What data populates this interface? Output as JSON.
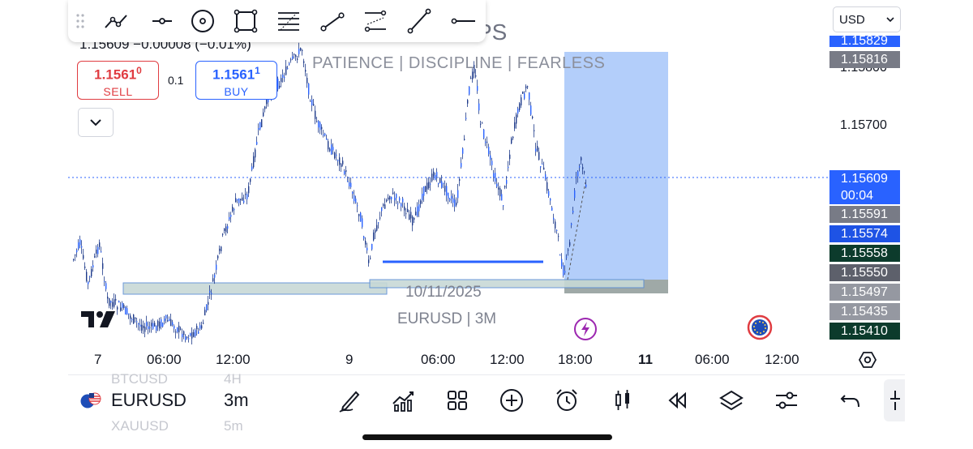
{
  "toolbar": {
    "tools": [
      "trend-line-tool",
      "horizontal-ray-tool",
      "circle-tool",
      "rectangle-tool",
      "fib-retracement-tool",
      "ray-tool",
      "parallel-channel-tool",
      "line-tool",
      "horizontal-line-tool"
    ]
  },
  "header": {
    "ohlc_text": "1.15609 −0.00008 (−0.01%)",
    "title_fragment": "PS",
    "motto": "PATIENCE  |  DISCIPLINE  |  FEARLESS",
    "lot_size": "0.1"
  },
  "trade": {
    "sell_price_main": "1.1561",
    "sell_price_sup": "0",
    "sell_label": "SELL",
    "buy_price_main": "1.1561",
    "buy_price_sup": "1",
    "buy_label": "BUY"
  },
  "currency_select": {
    "value": "USD"
  },
  "price_axis": {
    "plain_ticks": [
      "1.15800",
      "1.15700"
    ],
    "labels": [
      {
        "text": "1.15829",
        "bg": "#2962ff"
      },
      {
        "text": "1.15816",
        "bg": "#787b86"
      },
      {
        "text": "1.15609",
        "bg": "#2962ff"
      },
      {
        "text": "00:04",
        "bg": "#2962ff"
      },
      {
        "text": "1.15591",
        "bg": "#787b86"
      },
      {
        "text": "1.15574",
        "bg": "#1e53e5"
      },
      {
        "text": "1.15558",
        "bg": "#0c3b2c"
      },
      {
        "text": "1.15550",
        "bg": "#5d606b"
      },
      {
        "text": "1.15497",
        "bg": "#9598a1"
      },
      {
        "text": "1.15435",
        "bg": "#9598a1"
      },
      {
        "text": "1.15410",
        "bg": "#0c3b2c"
      }
    ]
  },
  "time_axis": [
    "7",
    "06:00",
    "12:00",
    "9",
    "06:00",
    "12:00",
    "18:00",
    "11",
    "06:00",
    "12:00"
  ],
  "watermark": {
    "date": "10/11/2025",
    "symbol": "EURUSD | 3M"
  },
  "bottom": {
    "symbol": "EURUSD",
    "interval": "3m",
    "ghost_prev_symbol": "BTCUSD",
    "ghost_prev_interval": "4H",
    "ghost_next_symbol": "XAUUSD",
    "ghost_next_interval": "5m",
    "icons": [
      "draw-icon",
      "indicators-icon",
      "layout-grid-icon",
      "add-icon",
      "alert-icon",
      "chart-type-icon",
      "replay-icon",
      "layers-icon",
      "settings-icon",
      "undo-icon"
    ]
  },
  "colors": {
    "candle": "#1e3a8a",
    "accent": "#2962ff",
    "sell": "#e03c41",
    "zone_fill": "#c8d9d6",
    "position_fill": "#8ab4f8"
  }
}
